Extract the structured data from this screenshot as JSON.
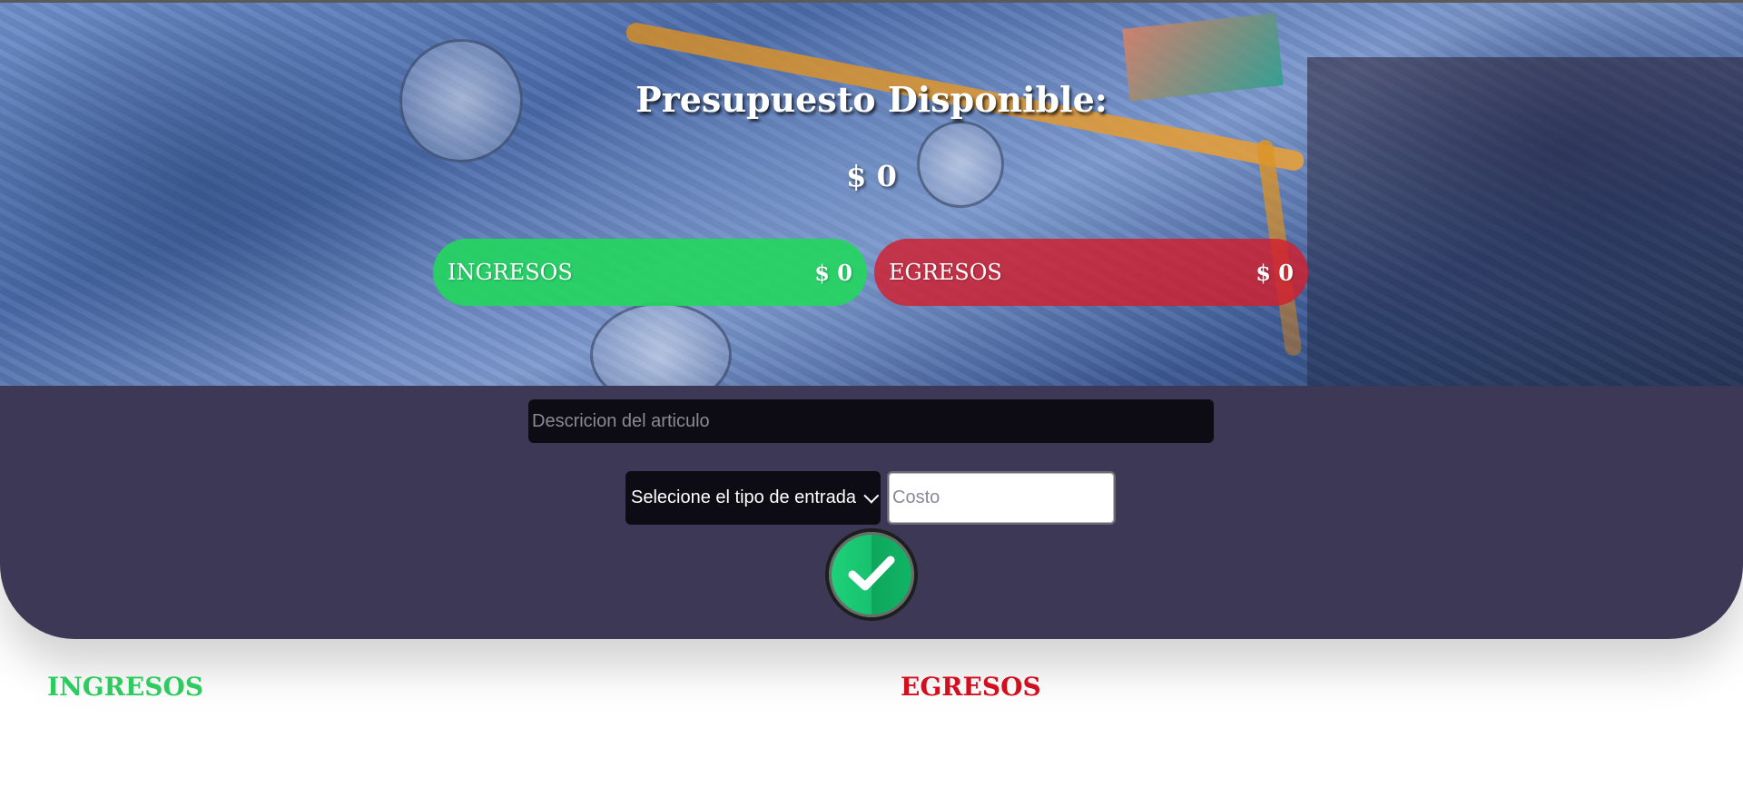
{
  "header": {
    "title": "Presupuesto Disponible:",
    "available_total": "$ 0",
    "income_pill": {
      "label": "INGRESOS",
      "amount": "$ 0"
    },
    "expense_pill": {
      "label": "EGRESOS",
      "amount": "$ 0"
    }
  },
  "form": {
    "description_placeholder": "Descricion del articulo",
    "type_select_value": "Selecione el tipo de entrada",
    "cost_placeholder": "Costo",
    "submit_icon": "check-icon"
  },
  "lists": {
    "income_title": "INGRESOS",
    "expense_title": "EGRESOS"
  },
  "colors": {
    "income": "#2ecc5e",
    "expense": "#d10f1e",
    "panel": "#3d3856",
    "input_dark": "#0d0c14"
  }
}
